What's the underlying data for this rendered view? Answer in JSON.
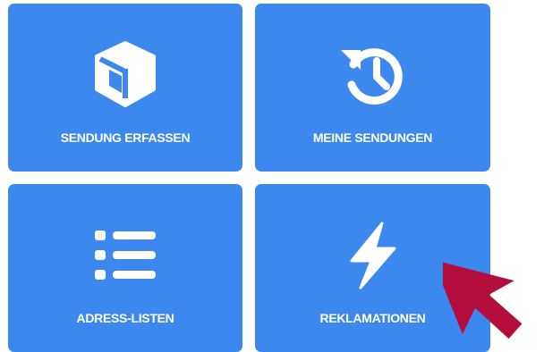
{
  "tiles": [
    {
      "icon": "box-icon",
      "label": "SENDUNG ERFASSEN"
    },
    {
      "icon": "history-icon",
      "label": "MEINE SENDUNGEN"
    },
    {
      "icon": "list-icon",
      "label": "ADRESS-LISTEN"
    },
    {
      "icon": "bolt-icon",
      "label": "REKLAMATIONEN"
    }
  ],
  "colors": {
    "tile_background": "#3d88ef",
    "tile_text": "#ffffff",
    "cursor_arrow": "#b30d3b"
  },
  "cursor": {
    "icon": "arrow-cursor-icon"
  }
}
